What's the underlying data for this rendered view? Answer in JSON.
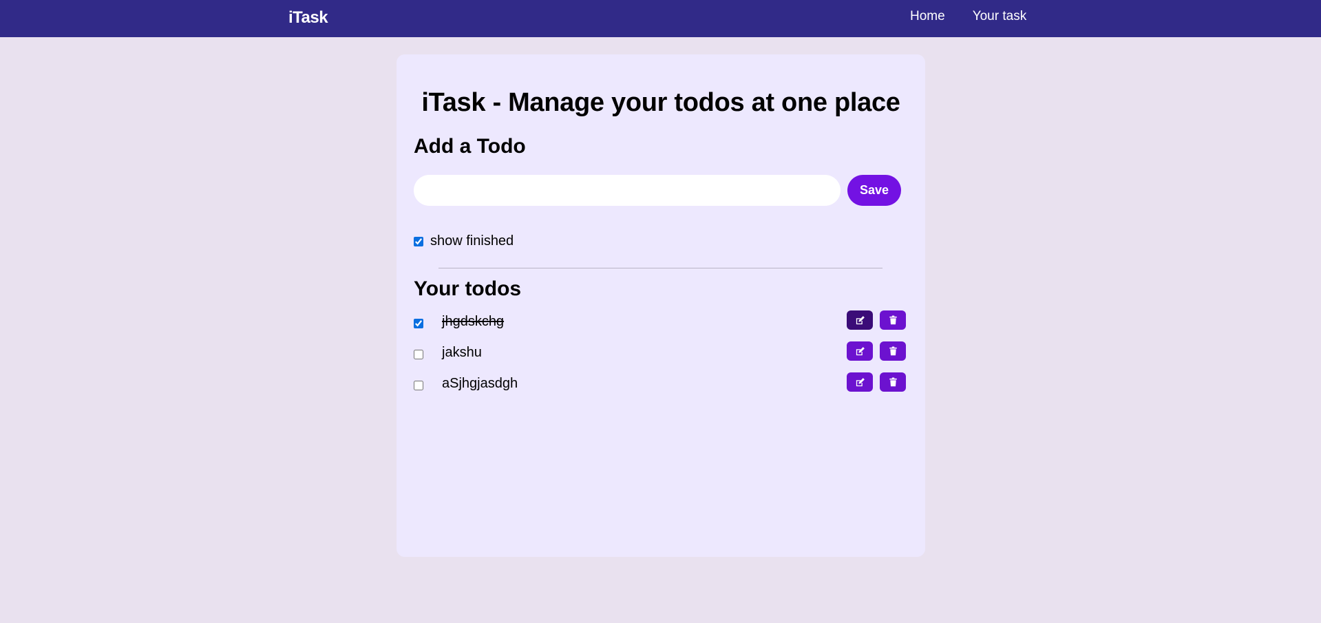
{
  "navbar": {
    "brand": "iTask",
    "links": [
      "Home",
      "Your task"
    ],
    "color": "#312a88"
  },
  "main": {
    "title": "iTask - Manage your todos at one place",
    "add_heading": "Add a Todo",
    "input": {
      "value": "",
      "placeholder": ""
    },
    "save_label": "Save",
    "show_finished": {
      "label": "show finished",
      "checked": true
    },
    "todos_heading": "Your todos",
    "todos": [
      {
        "text": "jhgdskchg",
        "done": true
      },
      {
        "text": "jakshu",
        "done": false
      },
      {
        "text": "aSjhgjasdgh",
        "done": false
      }
    ]
  },
  "icons": {
    "edit": "edit-icon",
    "delete": "trash-icon"
  },
  "colors": {
    "background": "#e9e1ef",
    "card": "#ede8fe",
    "accent": "#7312e3",
    "action_button": "#6c12cf"
  }
}
